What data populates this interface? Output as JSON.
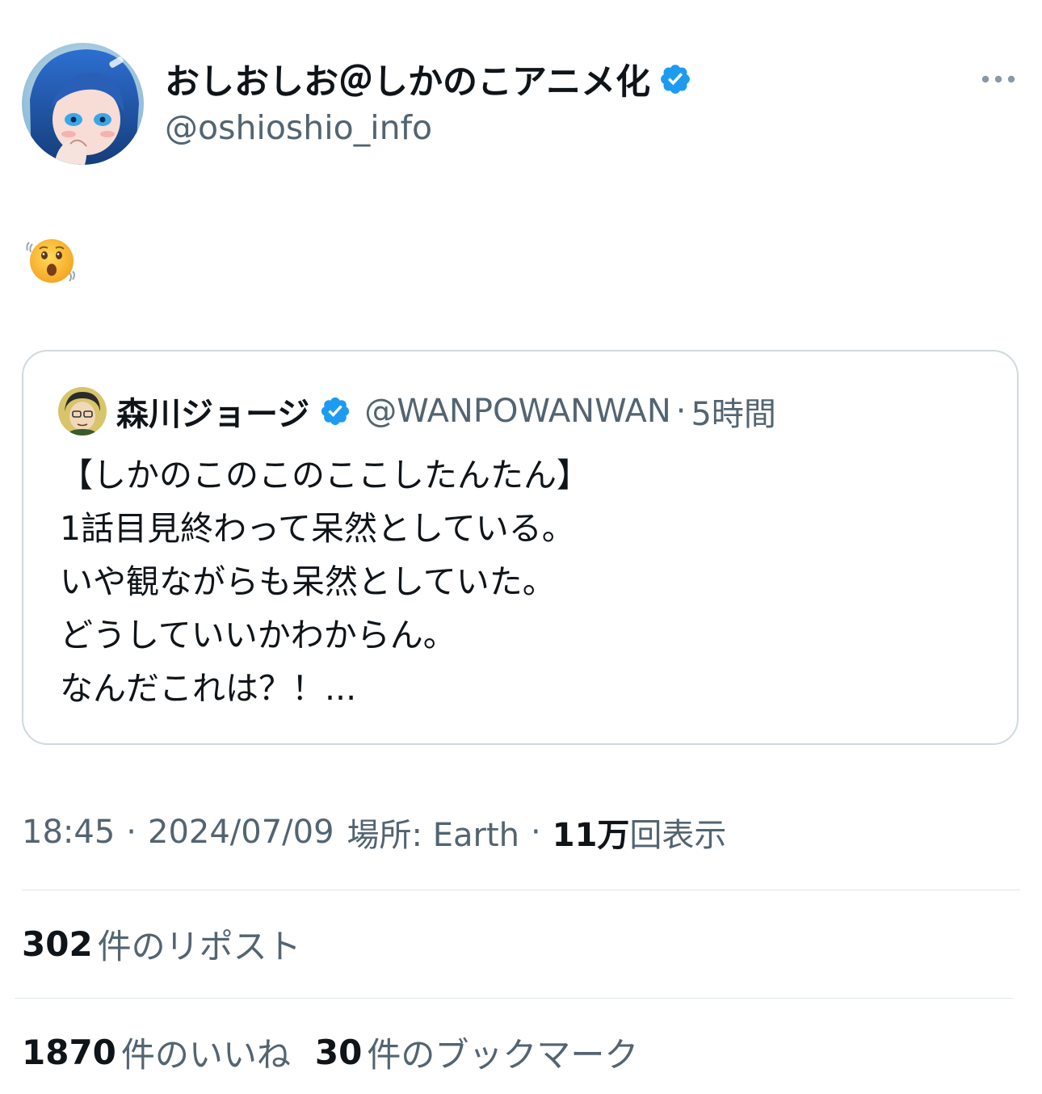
{
  "author": {
    "display_name": "おしおしお＠しかのこアニメ化",
    "handle": "@oshioshio_info",
    "verified": true,
    "avatar_icon": "anime-avatar-icon"
  },
  "more_icon": "more-horizontal-icon",
  "post": {
    "emoji": "😲"
  },
  "quote": {
    "display_name": "森川ジョージ",
    "handle": "@WANPOWANWAN",
    "separator": "·",
    "time": "5時間",
    "lines": [
      "【しかのこのこのここしたんたん】",
      "1話目見終わって呆然としている。",
      "いや観ながらも呆然としていた。",
      "どうしていいかわからん。",
      "なんだこれは？！..."
    ]
  },
  "meta": {
    "time": "18:45",
    "sep1": "·",
    "date": "2024/07/09",
    "location": "場所: Earth",
    "sep2": "·",
    "views_count": "11万",
    "views_label": "回表示"
  },
  "stats": {
    "reposts": {
      "count": "302",
      "label": "件のリポスト"
    },
    "likes": {
      "count": "1870",
      "label": "件のいいね"
    },
    "bookmarks": {
      "count": "30",
      "label": "件のブックマーク"
    }
  },
  "colors": {
    "verified": "#1d9bf0",
    "secondary_text": "#536471",
    "primary_text": "#0f1419",
    "border": "#cfd9de"
  }
}
